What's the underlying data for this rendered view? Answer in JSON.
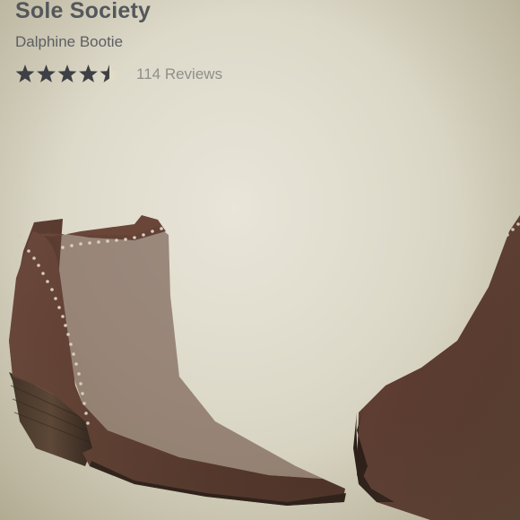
{
  "brand": "Sole Society",
  "product_name": "Dalphine Bootie",
  "rating": {
    "value": 4.5,
    "max": 5,
    "reviews_label": "114 Reviews",
    "filled_color": "#3f4045",
    "empty_color": "#e2dcc6"
  },
  "image": {
    "icon": "ankle-boot-photo",
    "boot_color": "#5b3b30"
  }
}
